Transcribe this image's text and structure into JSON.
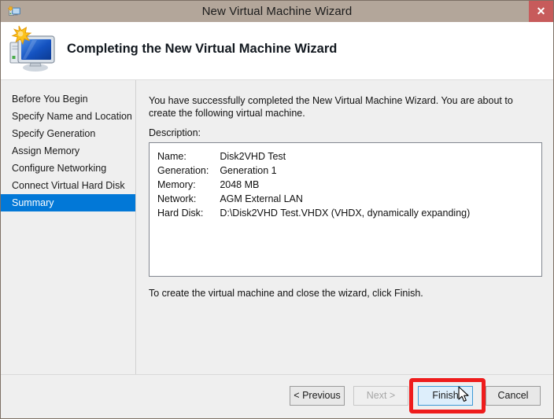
{
  "titlebar": {
    "title": "New Virtual Machine Wizard",
    "icon": "virtual-machine-icon",
    "close_label": "✕"
  },
  "header": {
    "title": "Completing the New Virtual Machine Wizard",
    "icon": "virtual-machine-monitor-icon"
  },
  "sidebar": {
    "items": [
      {
        "label": "Before You Begin",
        "selected": false
      },
      {
        "label": "Specify Name and Location",
        "selected": false
      },
      {
        "label": "Specify Generation",
        "selected": false
      },
      {
        "label": "Assign Memory",
        "selected": false
      },
      {
        "label": "Configure Networking",
        "selected": false
      },
      {
        "label": "Connect Virtual Hard Disk",
        "selected": false
      },
      {
        "label": "Summary",
        "selected": true
      }
    ],
    "selected_color": "#0278d7"
  },
  "content": {
    "intro_text": "You have successfully completed the New Virtual Machine Wizard. You are about to create the following virtual machine.",
    "description_label": "Description:",
    "summary_rows": [
      {
        "key": "Name:",
        "value": "Disk2VHD Test"
      },
      {
        "key": "Generation:",
        "value": "Generation 1"
      },
      {
        "key": "Memory:",
        "value": "2048 MB"
      },
      {
        "key": "Network:",
        "value": "AGM External LAN"
      },
      {
        "key": "Hard Disk:",
        "value": "D:\\Disk2VHD Test.VHDX (VHDX, dynamically expanding)"
      }
    ],
    "footer_hint": "To create the virtual machine and close the wizard, click Finish."
  },
  "buttons": {
    "previous": "< Previous",
    "next": "Next >",
    "finish": "Finish",
    "cancel": "Cancel"
  },
  "annotation": {
    "highlight_color": "#ee1c1c",
    "target": "finish-button"
  }
}
